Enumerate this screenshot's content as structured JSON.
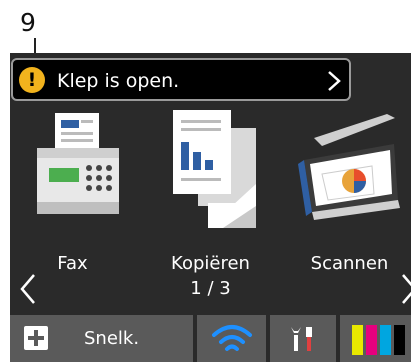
{
  "callout": {
    "number": "9"
  },
  "alert": {
    "message": "Klep is open.",
    "icon": "warning-icon",
    "icon_color": "#f2b31d"
  },
  "tiles": [
    {
      "label": "Fax",
      "icon": "fax-icon"
    },
    {
      "label": "Kopiëren",
      "icon": "copy-icon"
    },
    {
      "label": "Scannen",
      "icon": "scan-icon"
    }
  ],
  "pager": {
    "text": "1 / 3"
  },
  "bottom": {
    "shortcut_label": "Snelk.",
    "wifi_color": "#1e90ff",
    "ink_colors": [
      "#e8e800",
      "#e6007e",
      "#00a6e0",
      "#000000"
    ]
  }
}
